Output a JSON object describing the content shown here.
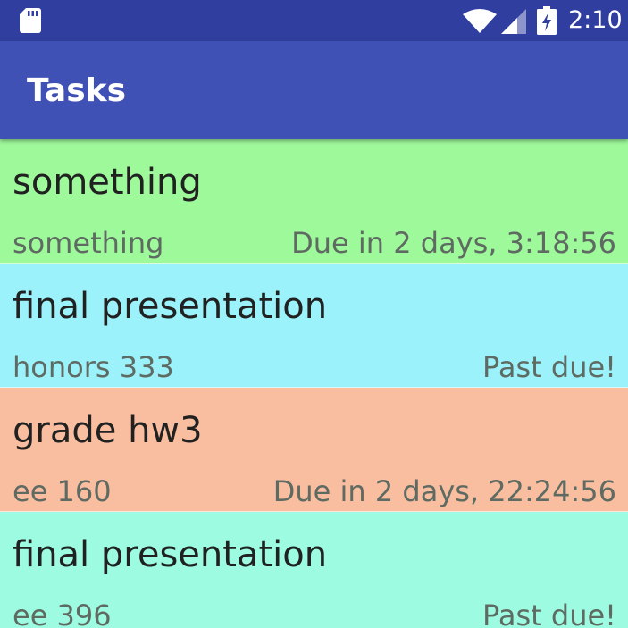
{
  "status_bar": {
    "time": "2:10",
    "icons": [
      "sd-card-icon",
      "wifi-icon",
      "signal-icon",
      "battery-charging-icon"
    ],
    "background": "#303f9f"
  },
  "app_bar": {
    "title": "Tasks",
    "background": "#3f51b5"
  },
  "tasks": [
    {
      "title": "something",
      "subtitle": "something",
      "due": "Due in 2 days, 3:18:56",
      "color": "#9ef99b"
    },
    {
      "title": "final presentation",
      "subtitle": "honors 333",
      "due": "Past due!",
      "color": "#9bf2fb"
    },
    {
      "title": "grade hw3",
      "subtitle": "ee 160",
      "due": "Due in 2 days, 22:24:56",
      "color": "#f8be9f"
    },
    {
      "title": "final presentation",
      "subtitle": "ee 396",
      "due": "Past due!",
      "color": "#9cfbe1"
    }
  ]
}
